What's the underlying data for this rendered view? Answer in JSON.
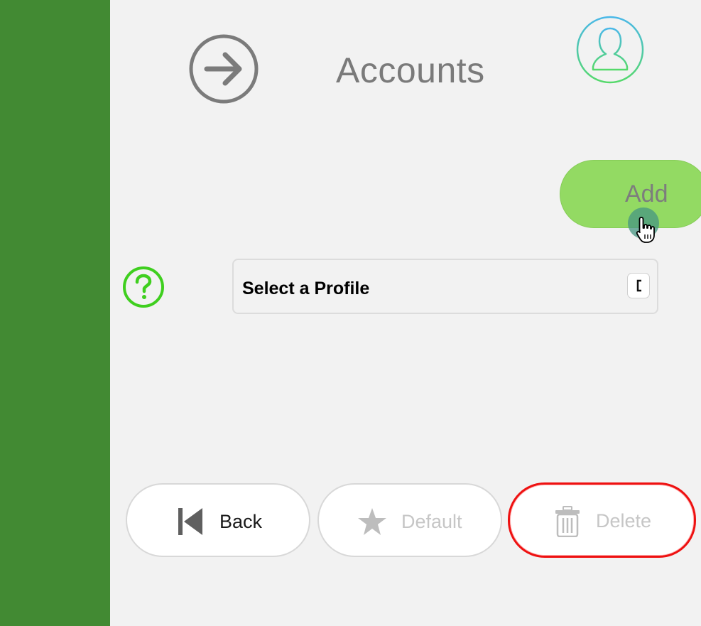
{
  "header": {
    "title": "Accounts",
    "forward_icon": "arrow-right-circle-icon",
    "avatar_icon": "user-profile-icon"
  },
  "actions": {
    "add_label": "Add"
  },
  "profile": {
    "help_icon": "question-circle-icon",
    "select_value": "Select a Profile"
  },
  "footer": {
    "back_label": "Back",
    "default_label": "Default",
    "delete_label": "Delete"
  },
  "colors": {
    "sidebar": "#428a33",
    "add_button": "#93da63",
    "help_icon": "#3fcf1f",
    "delete_border": "#ee1111"
  }
}
